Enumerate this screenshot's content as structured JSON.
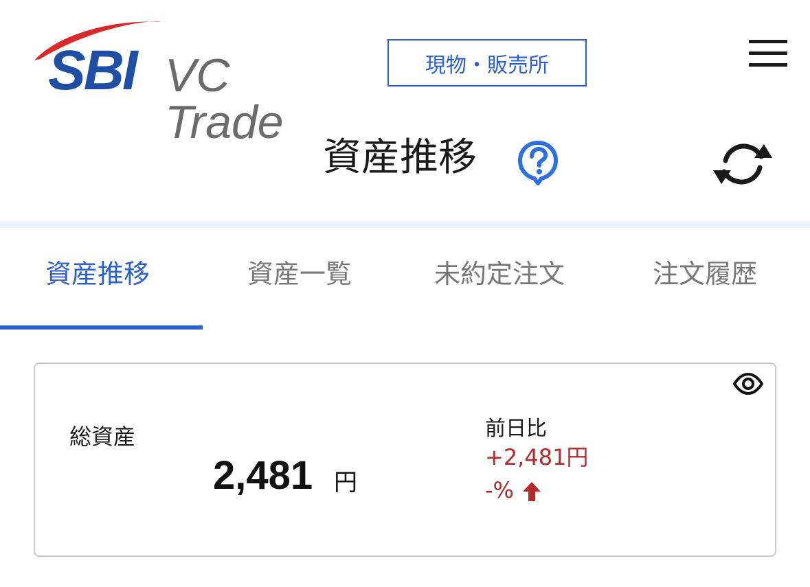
{
  "header": {
    "logo_text_sbi": "SBI",
    "logo_text_vc": "VC Trade",
    "badge_label": "現物・販売所",
    "menu_icon": "hamburger-menu-icon",
    "brand_color": "#1f4fa4",
    "accent_color": "#2c5fd0"
  },
  "title_row": {
    "title": "資産推移",
    "help_icon": "question-bubble-icon",
    "refresh_icon": "refresh-icon"
  },
  "tabs": [
    {
      "label": "資産推移",
      "active": true
    },
    {
      "label": "資産一覧",
      "active": false
    },
    {
      "label": "未約定注文",
      "active": false
    },
    {
      "label": "注文履歴",
      "active": false
    }
  ],
  "summary": {
    "total_label": "総資産",
    "total_value": "2,481",
    "total_unit": "円",
    "change_label": "前日比",
    "change_value": "+2,481円",
    "change_percent": "-%",
    "change_direction_icon": "up-arrow-icon",
    "change_color": "#b52a2a",
    "visibility_icon": "eye-icon"
  }
}
